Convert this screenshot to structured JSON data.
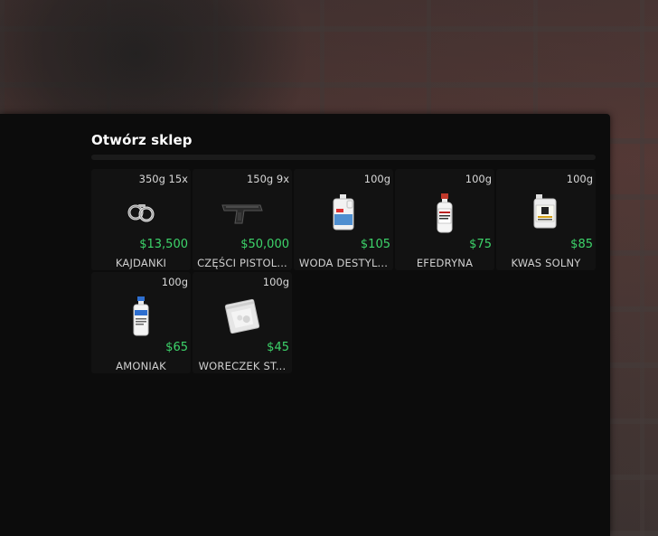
{
  "shop": {
    "title": "Otwórz sklep",
    "progress_fraction": 0.0,
    "items": [
      {
        "meta": "350g 15x",
        "price": "$13,500",
        "name": "KAJDANKI",
        "icon": "handcuffs-icon"
      },
      {
        "meta": "150g 9x",
        "price": "$50,000",
        "name": "CZĘŚCI PISTOL...",
        "icon": "pistol-parts-icon"
      },
      {
        "meta": "100g",
        "price": "$105",
        "name": "WODA DESTYL...",
        "icon": "distilled-water-canister-icon"
      },
      {
        "meta": "100g",
        "price": "$75",
        "name": "EFEDRYNA",
        "icon": "ephedrine-bottle-icon"
      },
      {
        "meta": "100g",
        "price": "$85",
        "name": "KWAS SOLNY",
        "icon": "acid-canister-icon"
      },
      {
        "meta": "100g",
        "price": "$65",
        "name": "AMONIAK",
        "icon": "ammonia-bottle-icon"
      },
      {
        "meta": "100g",
        "price": "$45",
        "name": "WORECZEK ST...",
        "icon": "plastic-bag-icon"
      }
    ]
  },
  "colors": {
    "panel_bg": "#0c0c0c",
    "card_bg": "#121212",
    "price_green": "#3dd46a",
    "title_white": "#ffffff"
  }
}
